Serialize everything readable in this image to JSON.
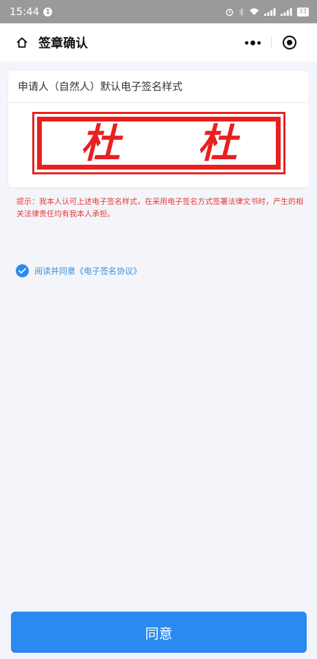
{
  "status_bar": {
    "time": "15:44",
    "notification_count": "1",
    "battery": "33"
  },
  "nav": {
    "title": "签章确认",
    "icons": [
      "home-icon",
      "more-icon",
      "close-target-icon"
    ]
  },
  "card": {
    "title": "申请人（自然人）默认电子签名样式",
    "signature_chars": [
      "杜",
      "杜"
    ]
  },
  "tip": "提示：我本人认可上述电子签名样式，在采用电子签名方式签署法律文书时，产生的相关法律责任均有我本人承担。",
  "agreement": {
    "checked": true,
    "text": "阅读并同意《电子签名协议》"
  },
  "footer": {
    "agree_label": "同意"
  },
  "colors": {
    "accent": "#2b8af0",
    "seal": "#e8211f",
    "tip": "#e23b36"
  }
}
